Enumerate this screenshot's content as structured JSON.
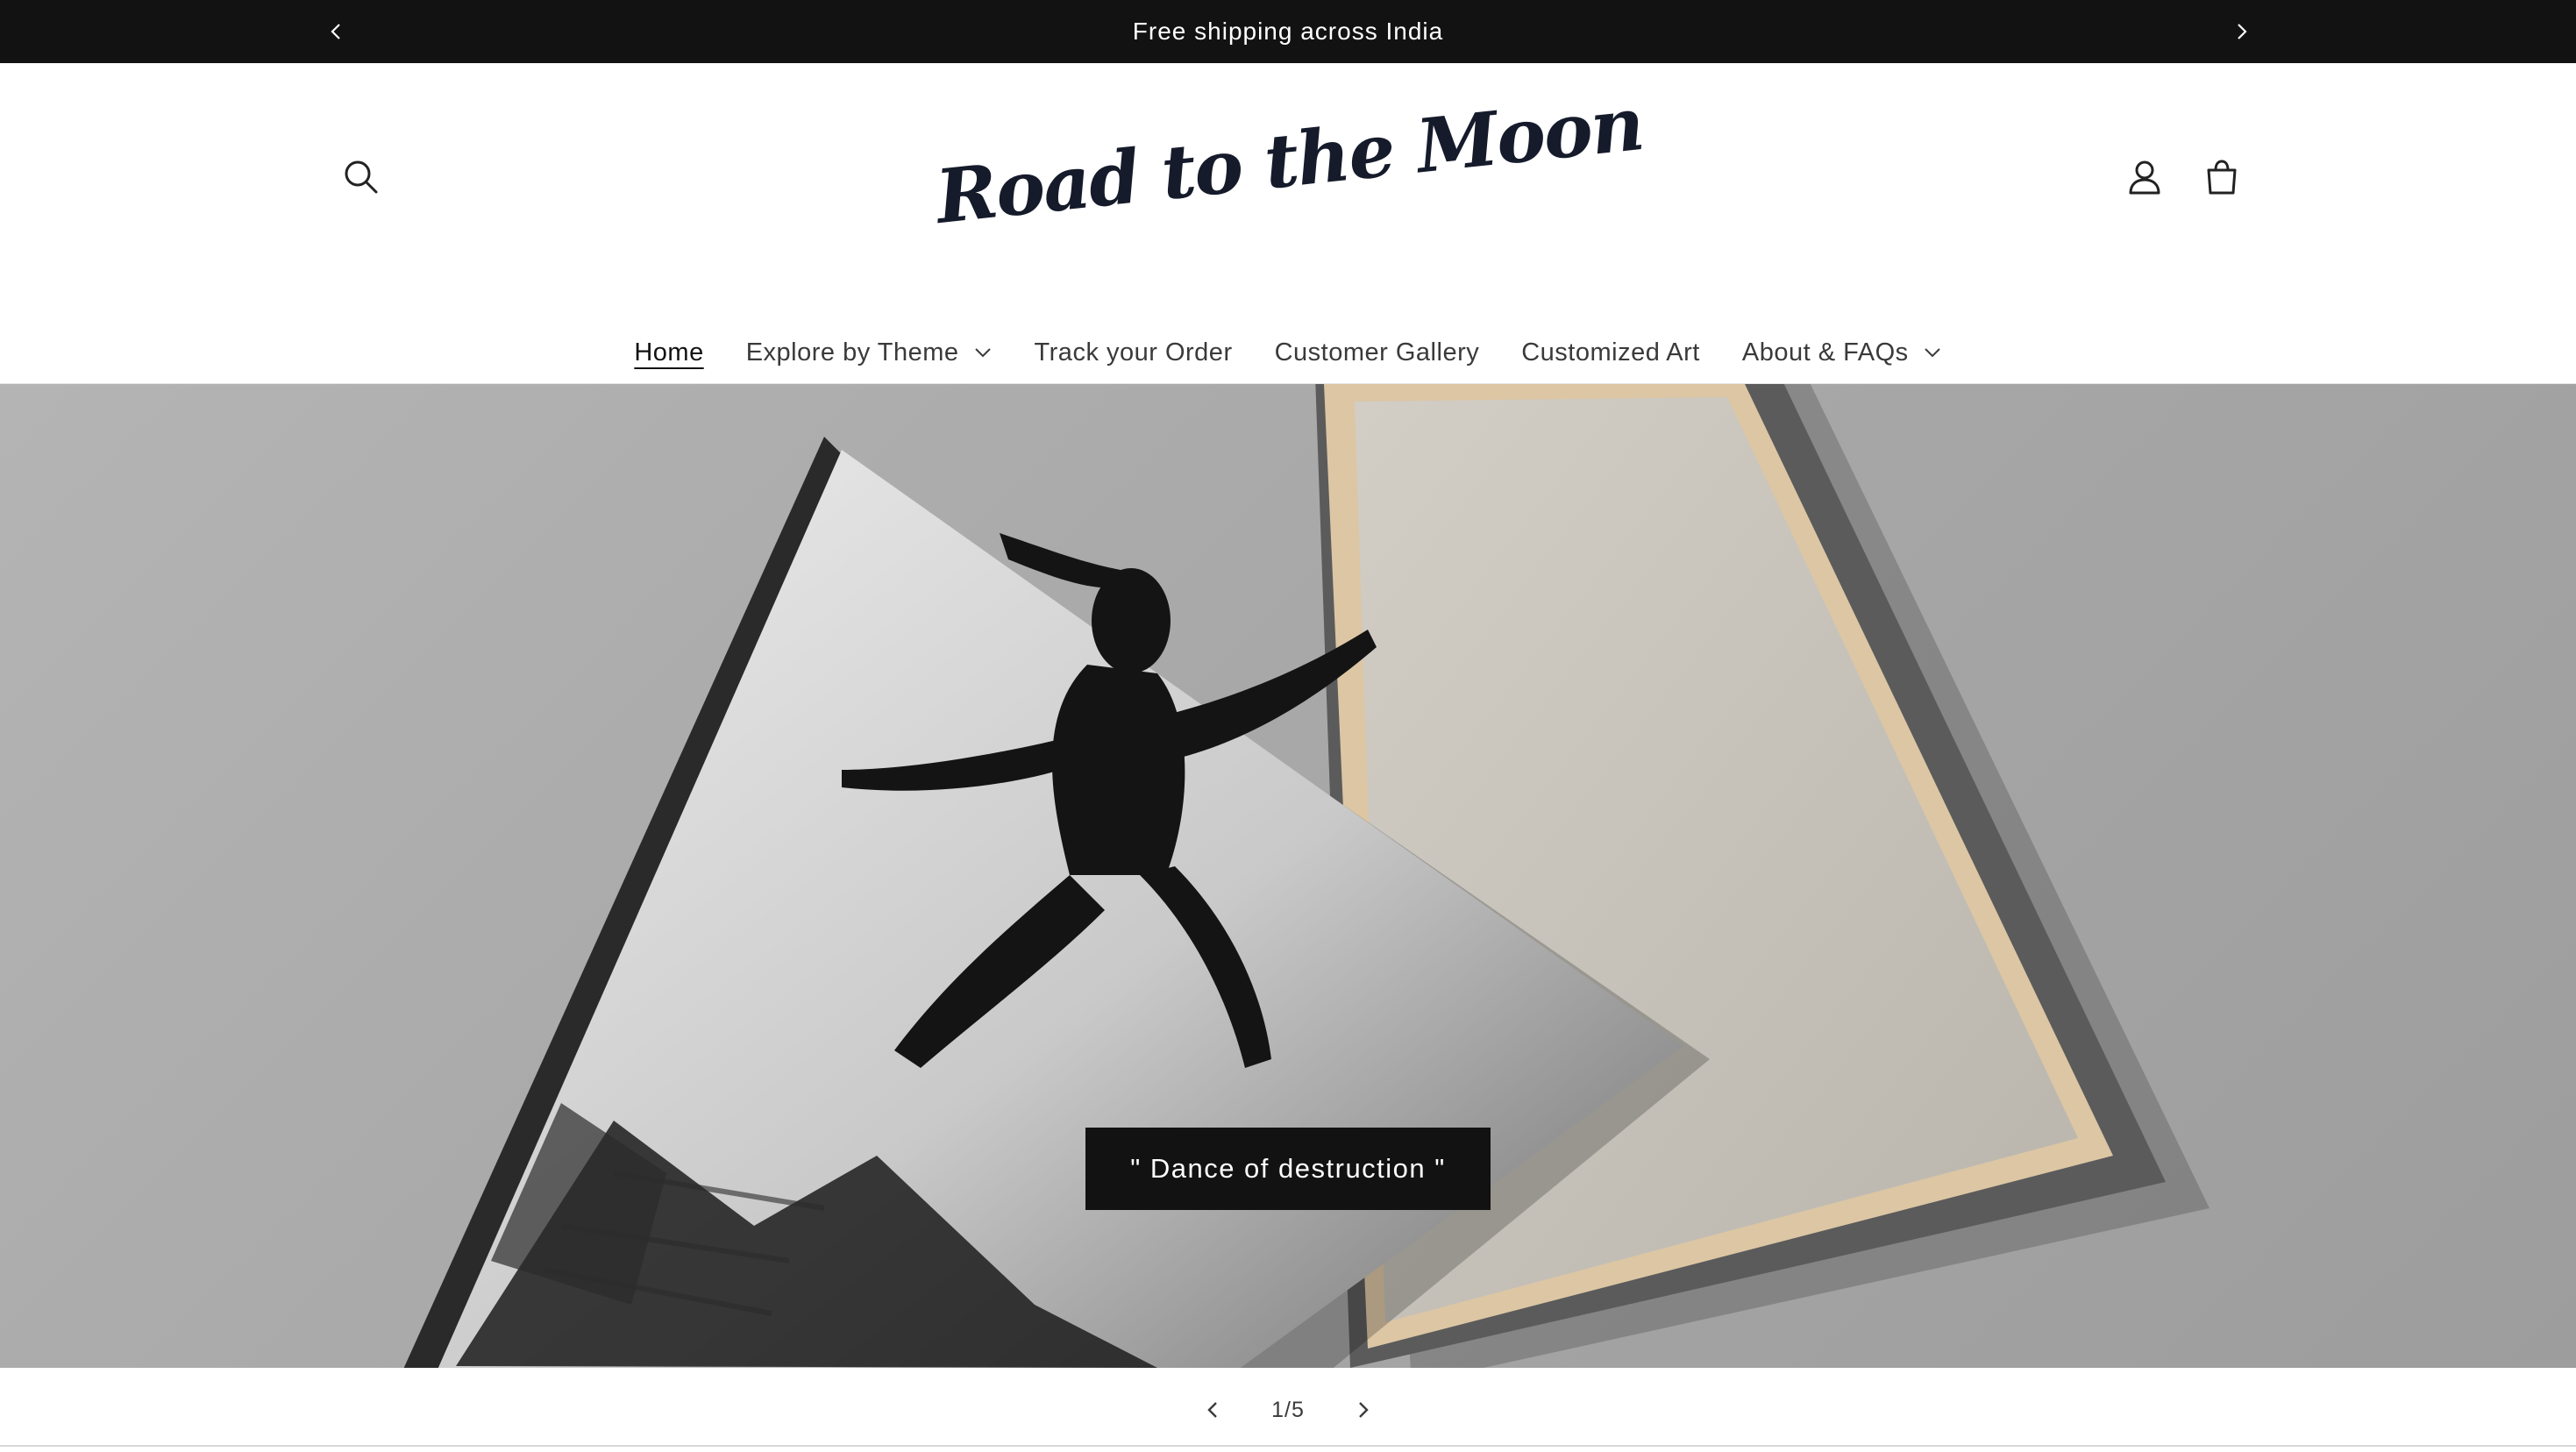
{
  "announcement": {
    "text": "Free shipping across India",
    "prev_icon": "chevron-left-icon",
    "next_icon": "chevron-right-icon"
  },
  "header": {
    "logo_text": "Road to the Moon",
    "icons": [
      "search-icon",
      "account-icon",
      "cart-icon"
    ]
  },
  "nav": {
    "items": [
      {
        "label": "Home",
        "active": true,
        "dropdown": false
      },
      {
        "label": "Explore by Theme",
        "active": false,
        "dropdown": true
      },
      {
        "label": "Track your Order",
        "active": false,
        "dropdown": false
      },
      {
        "label": "Customer Gallery",
        "active": false,
        "dropdown": false
      },
      {
        "label": "Customized Art",
        "active": false,
        "dropdown": false
      },
      {
        "label": "About & FAQs",
        "active": false,
        "dropdown": true
      }
    ]
  },
  "slideshow": {
    "caption": "\" Dance of destruction \"",
    "counter": "1/5",
    "current": 1,
    "total": 5
  },
  "colors": {
    "announcement_bg": "#121212",
    "caption_bg": "#121212",
    "logo": "#161b2b"
  }
}
